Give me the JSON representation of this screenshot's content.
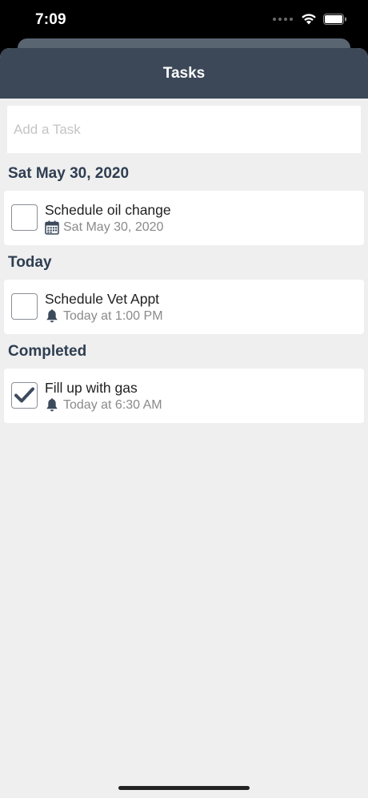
{
  "status_bar": {
    "time": "7:09"
  },
  "header": {
    "title": "Tasks"
  },
  "add_task": {
    "placeholder": "Add a Task"
  },
  "sections": [
    {
      "title": "Sat May 30, 2020",
      "tasks": [
        {
          "title": "Schedule oil change",
          "meta": "Sat May 30, 2020",
          "icon": "calendar-icon",
          "checked": false
        }
      ]
    },
    {
      "title": "Today",
      "tasks": [
        {
          "title": "Schedule Vet Appt",
          "meta": "Today at 1:00 PM",
          "icon": "bell-icon",
          "checked": false
        }
      ]
    },
    {
      "title": "Completed",
      "tasks": [
        {
          "title": "Fill up with gas",
          "meta": "Today at 6:30 AM",
          "icon": "bell-icon",
          "checked": true
        }
      ]
    }
  ],
  "colors": {
    "nav_background": "#3c4858",
    "section_header": "#2f3e52",
    "background": "#efefef"
  }
}
